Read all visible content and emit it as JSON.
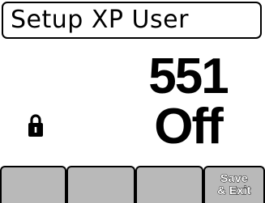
{
  "header": {
    "title": "Setup XP User"
  },
  "main": {
    "value": "551",
    "state": "Off",
    "lock_icon": "lock-icon"
  },
  "softkeys": [
    {
      "line1": "",
      "line2": ""
    },
    {
      "line1": "",
      "line2": ""
    },
    {
      "line1": "",
      "line2": ""
    },
    {
      "line1": "Save",
      "line2": "& Exit"
    }
  ],
  "colors": {
    "background": "#ffffff",
    "text": "#000000",
    "softkey_fill": "#b9b9b9",
    "softkey_text": "#ffffff"
  }
}
